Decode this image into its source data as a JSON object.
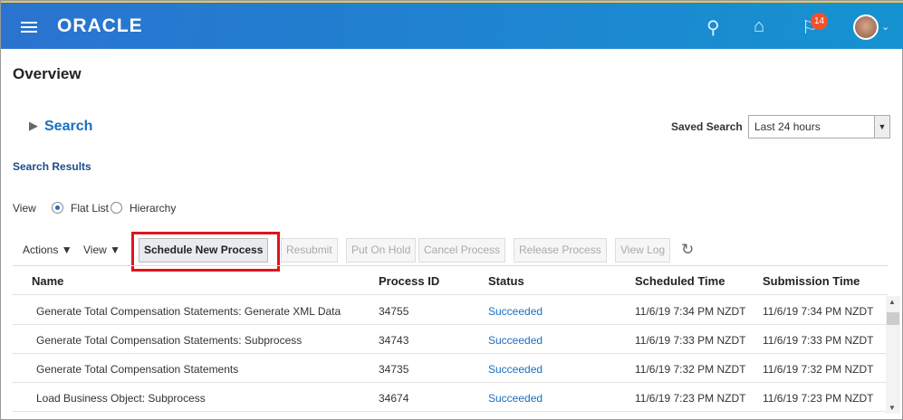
{
  "header": {
    "logo": "ORACLE",
    "notification_count": "14"
  },
  "page_title": "Overview",
  "search": {
    "label": "Search",
    "saved_search_label": "Saved Search",
    "saved_search_value": "Last 24 hours"
  },
  "results": {
    "title": "Search Results",
    "view_label": "View",
    "view_options": [
      "Flat List",
      "Hierarchy"
    ],
    "selected": "Flat List"
  },
  "toolbar": {
    "actions": "Actions",
    "view": "View",
    "buttons": [
      "Schedule New Process",
      "Resubmit",
      "Put On Hold",
      "Cancel Process",
      "Release Process",
      "View Log"
    ]
  },
  "table": {
    "columns": [
      "Name",
      "Process ID",
      "Status",
      "Scheduled Time",
      "Submission Time"
    ],
    "rows": [
      [
        "Generate Total Compensation Statements: Generate XML Data",
        "34755",
        "Succeeded",
        "11/6/19 7:34 PM NZDT",
        "11/6/19 7:34 PM NZDT"
      ],
      [
        "Generate Total Compensation Statements: Subprocess",
        "34743",
        "Succeeded",
        "11/6/19 7:33 PM NZDT",
        "11/6/19 7:33 PM NZDT"
      ],
      [
        "Generate Total Compensation Statements",
        "34735",
        "Succeeded",
        "11/6/19 7:32 PM NZDT",
        "11/6/19 7:32 PM NZDT"
      ],
      [
        "Load Business Object: Subprocess",
        "34674",
        "Succeeded",
        "11/6/19 7:23 PM NZDT",
        "11/6/19 7:23 PM NZDT"
      ]
    ]
  }
}
